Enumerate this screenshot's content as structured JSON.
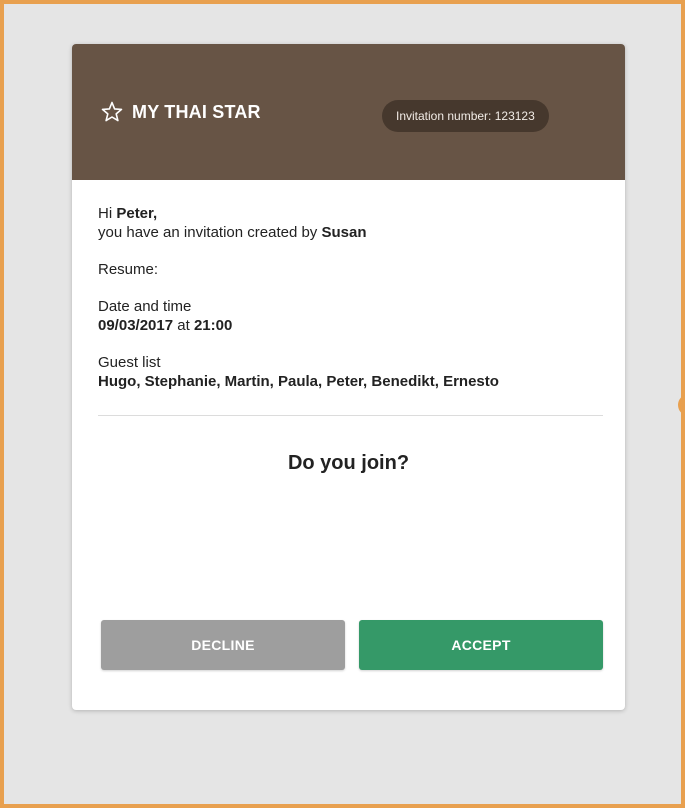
{
  "colors": {
    "frame_border": "#e8a04f",
    "page_background": "#e5e5e5",
    "header_background": "#675445",
    "pill_background": "#46382d",
    "decline_button": "#9e9e9e",
    "accept_button": "#359968"
  },
  "header": {
    "brand_icon": "star-outline-icon",
    "brand_name": "MY THAI STAR",
    "invitation_label": "Invitation number:",
    "invitation_number": "123123"
  },
  "greeting": {
    "hi": "Hi",
    "name": "Peter,",
    "created_by_text": "you have an invitation created by",
    "creator": "Susan"
  },
  "resume_label": "Resume:",
  "datetime": {
    "label": "Date and time",
    "date": "09/03/2017",
    "at": "at",
    "time": "21:00"
  },
  "guests": {
    "label": "Guest list",
    "list": "Hugo, Stephanie, Martin, Paula, Peter, Benedikt, Ernesto"
  },
  "question": "Do you join?",
  "buttons": {
    "decline": "DECLINE",
    "accept": "ACCEPT"
  }
}
